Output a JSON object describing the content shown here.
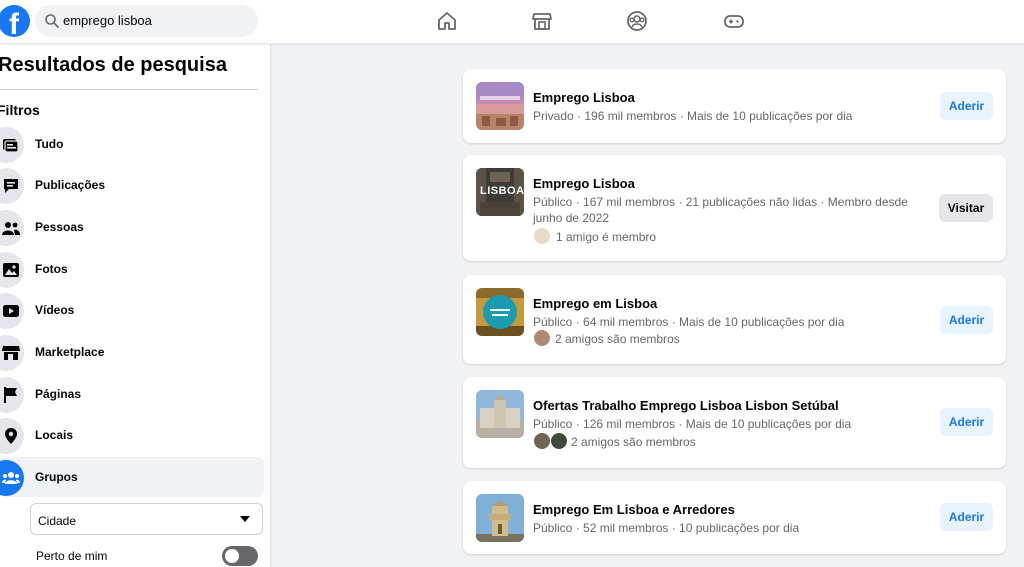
{
  "topbar": {
    "logo": "f",
    "search_value": "emprego lisboa",
    "nav_icons": [
      "home-icon",
      "marketplace-icon",
      "groups-icon",
      "gaming-icon"
    ]
  },
  "sidebar": {
    "title": "Resultados de pesquisa",
    "filters_heading": "Filtros",
    "items": [
      {
        "label": "Tudo",
        "icon": "all-icon"
      },
      {
        "label": "Publicações",
        "icon": "posts-icon"
      },
      {
        "label": "Pessoas",
        "icon": "people-icon"
      },
      {
        "label": "Fotos",
        "icon": "photos-icon"
      },
      {
        "label": "Vídeos",
        "icon": "videos-icon"
      },
      {
        "label": "Marketplace",
        "icon": "marketplace-icon"
      },
      {
        "label": "Páginas",
        "icon": "pages-icon"
      },
      {
        "label": "Locais",
        "icon": "places-icon"
      },
      {
        "label": "Grupos",
        "icon": "groups-icon"
      }
    ],
    "active_item": "Grupos",
    "city_select": "Cidade",
    "near_me_label": "Perto de mim",
    "near_me_on": false
  },
  "results": [
    {
      "title": "Emprego Lisboa",
      "meta": "Privado · 196 mil membros · Mais de 10 publicações por dia",
      "friends": "",
      "button": "Aderir"
    },
    {
      "title": "Emprego Lisboa",
      "meta": "Público · 167 mil membros · 21 publicações não lidas · Membro desde junho de 2022",
      "friends": "1 amigo é membro",
      "button": "Visitar",
      "thumb_text": "LISBOA"
    },
    {
      "title": "Emprego em Lisboa",
      "meta": "Público · 64 mil membros · Mais de 10 publicações por dia",
      "friends": "2 amigos são membros",
      "button": "Aderir"
    },
    {
      "title": "Ofertas Trabalho Emprego Lisboa Lisbon Setúbal",
      "meta": "Público · 126 mil membros · Mais de 10 publicações por dia",
      "friends": "2 amigos são membros",
      "button": "Aderir"
    },
    {
      "title": "Emprego Em Lisboa e Arredores",
      "meta": "Público · 52 mil membros · 10 publicações por dia",
      "friends": "",
      "button": "Aderir"
    }
  ],
  "colors": {
    "brand": "#1877f2",
    "background": "#f0f2f5",
    "secondary_text": "#65676b"
  }
}
